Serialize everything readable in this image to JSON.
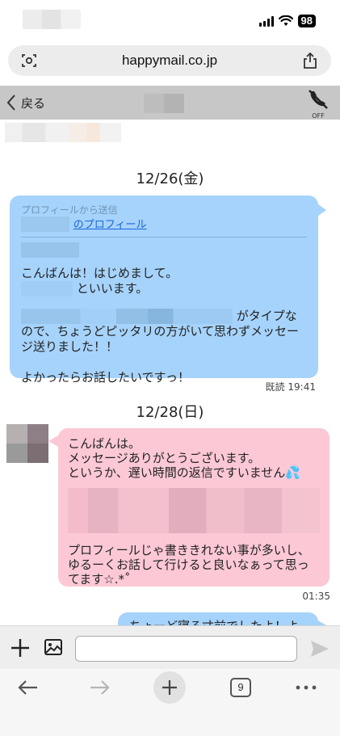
{
  "status": {
    "battery": "98"
  },
  "browser": {
    "url": "happymail.co.jp",
    "tab_count": "9"
  },
  "header": {
    "back_label": "戻る",
    "call_off_label": "OFF"
  },
  "messages": {
    "date1": "12/26(金)",
    "date2": "12/28(日)",
    "first": {
      "profile_from": "プロフィールから送信",
      "profile_link": "のプロフィール",
      "greeting": "こんばんは！はじめまして。",
      "name_line": "といいます。",
      "type_line_end": "がタイプな",
      "body": "ので、ちょうどピッタリの方がいて思わずメッセージ送りました！！\n\nよかったらお話したいですっ！",
      "read_time": "既読  19:41"
    },
    "second": {
      "intro": "こんばんは。\nメッセージありがとうございます。\nというか、遅い時間の返信ですいません💦",
      "body": "プロフィールじゃ書ききれない事が多いし、ゆるーくお話して行けると良いなぁって思ってます☆.*˚",
      "time": "01:35"
    },
    "third": {
      "partial": "ちょーど寝る寸前でしたよ！よ"
    }
  },
  "composer": {
    "input_value": ""
  }
}
